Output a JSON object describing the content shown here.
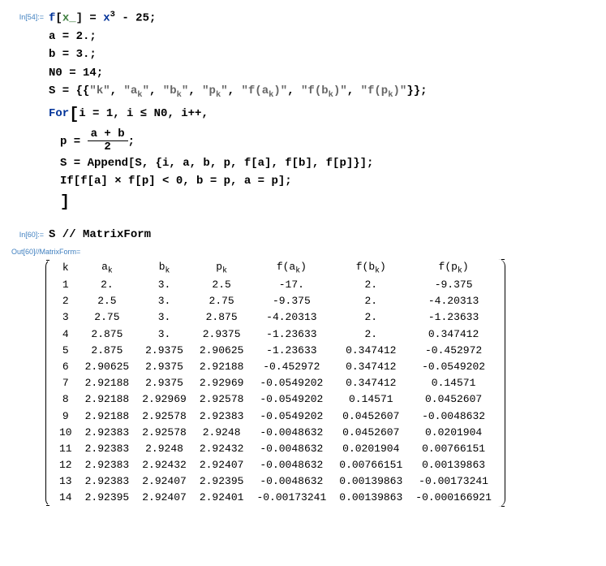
{
  "input_label_1": "In[54]:=",
  "input_label_2": "In[60]:=",
  "output_label": "Out[60]//MatrixForm=",
  "code": {
    "l1_f": "f",
    "l1_lbr": "[",
    "l1_x": "x_",
    "l1_rbr": "]",
    "l1_eq": " = ",
    "l1_x2": "x",
    "l1_exp": "3",
    "l1_minus": " - 25;",
    "l2_a": "a = 2.;",
    "l3_b": "b = 3.;",
    "l4_n0": "N0 = 14;",
    "l5_pre": "S = {{",
    "l5_s1": "\"k\"",
    "l5_c": ", ",
    "l5_s2": "\"a",
    "l5_sub_k": "k",
    "l5_s2e": "\"",
    "l5_s3": "\"b",
    "l5_s3e": "\"",
    "l5_s4": "\"p",
    "l5_s4e": "\"",
    "l5_s5": "\"f(a",
    "l5_s5e": ")\"",
    "l5_s6": "\"f(b",
    "l5_s6e": ")\"",
    "l5_s7": "\"f(p",
    "l5_s7e": ")\"",
    "l5_post": "}};",
    "l6_for": "For",
    "l6_args": "i = 1, i ≤ N0, i++,",
    "l7_p": "p = ",
    "l7_top": "a + b",
    "l7_bot": "2",
    "l7_end": ";",
    "l8": "S = Append[S, {i, a, b, p, f[a], f[b], f[p]}];",
    "l9": "If[f[a] × f[p] < 0, b = p, a = p];",
    "l11": "S // MatrixForm"
  },
  "chart_data": {
    "type": "table",
    "headers": [
      "k",
      "a_k",
      "b_k",
      "p_k",
      "f(a_k)",
      "f(b_k)",
      "f(p_k)"
    ],
    "rows": [
      [
        "1",
        "2.",
        "3.",
        "2.5",
        "-17.",
        "2.",
        "-9.375"
      ],
      [
        "2",
        "2.5",
        "3.",
        "2.75",
        "-9.375",
        "2.",
        "-4.20313"
      ],
      [
        "3",
        "2.75",
        "3.",
        "2.875",
        "-4.20313",
        "2.",
        "-1.23633"
      ],
      [
        "4",
        "2.875",
        "3.",
        "2.9375",
        "-1.23633",
        "2.",
        "0.347412"
      ],
      [
        "5",
        "2.875",
        "2.9375",
        "2.90625",
        "-1.23633",
        "0.347412",
        "-0.452972"
      ],
      [
        "6",
        "2.90625",
        "2.9375",
        "2.92188",
        "-0.452972",
        "0.347412",
        "-0.0549202"
      ],
      [
        "7",
        "2.92188",
        "2.9375",
        "2.92969",
        "-0.0549202",
        "0.347412",
        "0.14571"
      ],
      [
        "8",
        "2.92188",
        "2.92969",
        "2.92578",
        "-0.0549202",
        "0.14571",
        "0.0452607"
      ],
      [
        "9",
        "2.92188",
        "2.92578",
        "2.92383",
        "-0.0549202",
        "0.0452607",
        "-0.0048632"
      ],
      [
        "10",
        "2.92383",
        "2.92578",
        "2.9248",
        "-0.0048632",
        "0.0452607",
        "0.0201904"
      ],
      [
        "11",
        "2.92383",
        "2.9248",
        "2.92432",
        "-0.0048632",
        "0.0201904",
        "0.00766151"
      ],
      [
        "12",
        "2.92383",
        "2.92432",
        "2.92407",
        "-0.0048632",
        "0.00766151",
        "0.00139863"
      ],
      [
        "13",
        "2.92383",
        "2.92407",
        "2.92395",
        "-0.0048632",
        "0.00139863",
        "-0.00173241"
      ],
      [
        "14",
        "2.92395",
        "2.92407",
        "2.92401",
        "-0.00173241",
        "0.00139863",
        "-0.000166921"
      ]
    ]
  }
}
